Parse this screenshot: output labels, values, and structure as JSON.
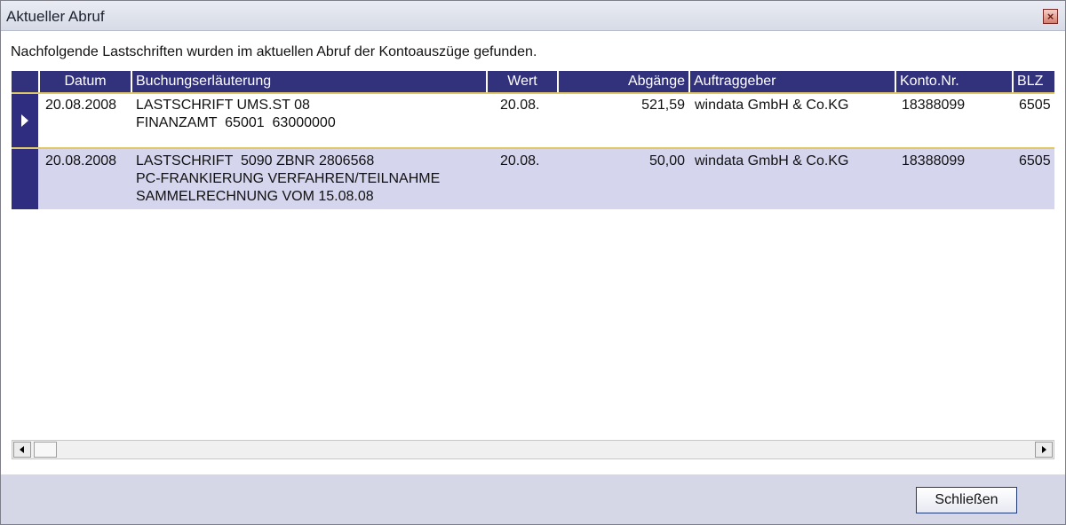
{
  "window": {
    "title": "Aktueller Abruf"
  },
  "intro": "Nachfolgende Lastschriften wurden im aktuellen Abruf der Kontoauszüge gefunden.",
  "table": {
    "headers": [
      "Datum",
      "Buchungserläuterung",
      "Wert",
      "Abgänge",
      "Auftraggeber",
      "Konto.Nr.",
      "BLZ"
    ],
    "rows": [
      {
        "datum": "20.08.2008",
        "buchung": [
          "LASTSCHRIFT UMS.ST 08",
          "FINANZAMT  65001  63000000"
        ],
        "wert": "20.08.",
        "abgaenge": "521,59",
        "auftraggeber": "windata GmbH & Co.KG",
        "konto": "18388099",
        "blz": "6505"
      },
      {
        "datum": "20.08.2008",
        "buchung": [
          "LASTSCHRIFT  5090 ZBNR 2806568",
          "PC-FRANKIERUNG VERFAHREN/TEILNAHME",
          "SAMMELRECHNUNG VOM 15.08.08"
        ],
        "wert": "20.08.",
        "abgaenge": "50,00",
        "auftraggeber": "windata GmbH & Co.KG",
        "konto": "18388099",
        "blz": "6505"
      }
    ]
  },
  "buttons": {
    "close_label": "Schließen"
  },
  "icons": {
    "close": "close-icon",
    "row_pointer": "row-pointer-icon",
    "scroll_left": "scroll-left-icon",
    "scroll_right": "scroll-right-icon"
  },
  "colors": {
    "header_bg": "#32317b",
    "selected_border": "#e1c866",
    "row_alt_bg": "#d5d5ee",
    "window_bg": "#d6d7e6"
  }
}
